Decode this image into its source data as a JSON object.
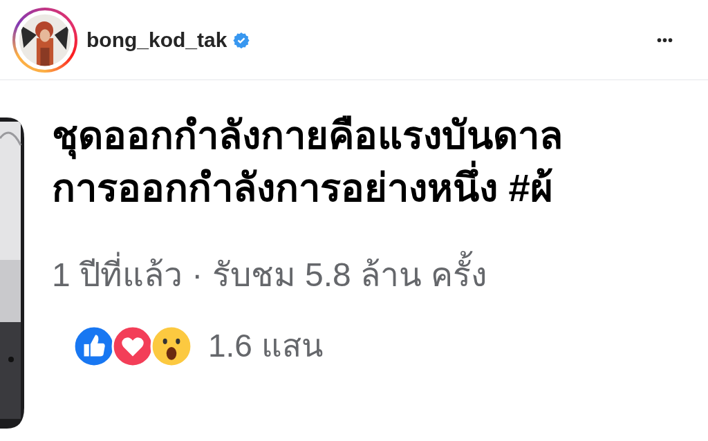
{
  "post_header": {
    "username": "bong_kod_tak",
    "verified": true,
    "more": "•••"
  },
  "shared_post": {
    "text_lines": [
      "ชุดออกกำลังกายคือแรงบันดาล",
      "การออกกำลังการอย่างหนึ่ง #ผ้"
    ],
    "meta": "1 ปีที่แล้ว · รับชม 5.8 ล้าน ครั้ง",
    "reactions": [
      {
        "kind": "like"
      },
      {
        "kind": "love"
      },
      {
        "kind": "wow"
      }
    ],
    "reaction_count": "1.6 แสน"
  }
}
